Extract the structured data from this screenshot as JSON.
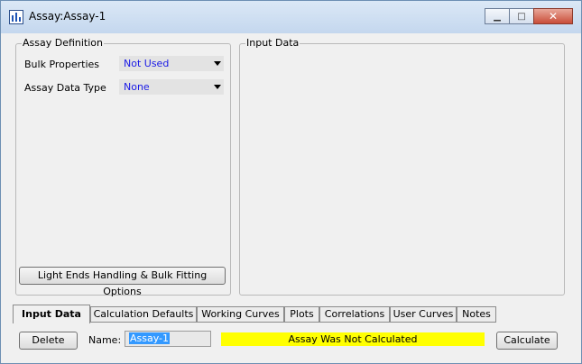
{
  "window": {
    "title": "Assay:Assay-1",
    "minimize_glyph": "▁",
    "maximize_glyph": "□",
    "close_glyph": "✕"
  },
  "assay_definition": {
    "label": "Assay Definition",
    "bulk_properties": {
      "label": "Bulk Properties",
      "value": "Not Used"
    },
    "assay_data_type": {
      "label": "Assay Data Type",
      "value": "None"
    },
    "light_ends_button": "Light Ends Handling & Bulk Fitting Options"
  },
  "input_data_group": {
    "label": "Input Data"
  },
  "tabs": [
    "Input Data",
    "Calculation Defaults",
    "Working Curves",
    "Plots",
    "Correlations",
    "User Curves",
    "Notes"
  ],
  "bottom": {
    "delete_label": "Delete",
    "name_label": "Name:",
    "name_value": "Assay-1",
    "status_text": "Assay Was Not Calculated",
    "status_color": "#ffff00",
    "calculate_label": "Calculate"
  }
}
